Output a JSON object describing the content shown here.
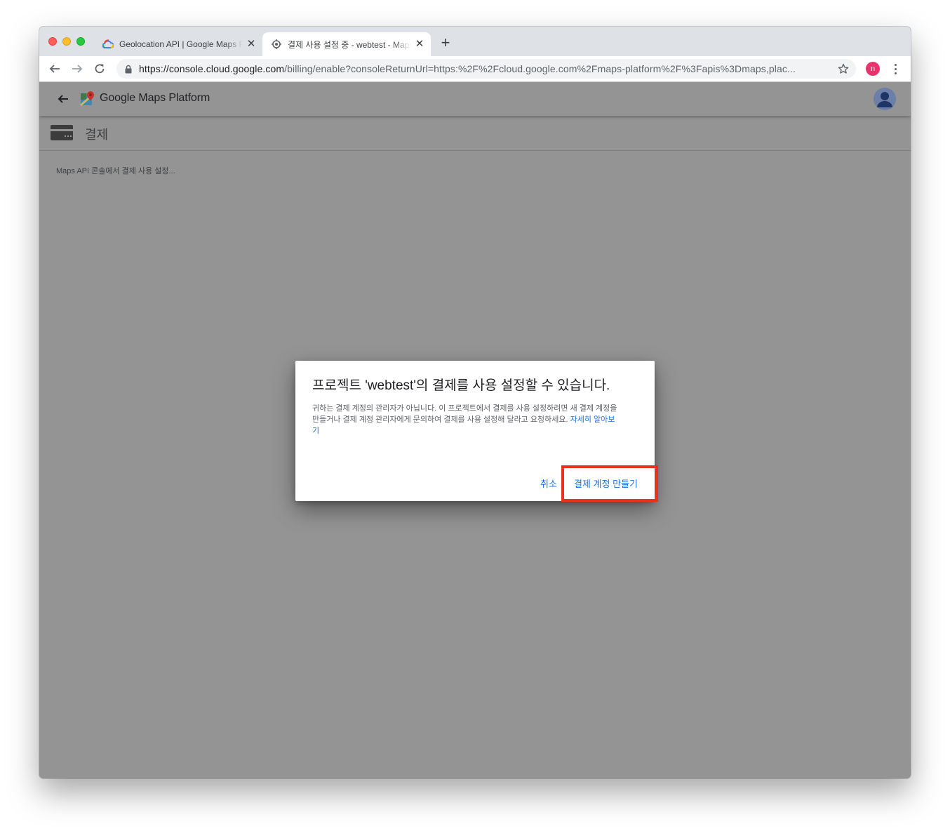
{
  "browser": {
    "tabs": [
      {
        "title": "Geolocation API | Google Maps Platform",
        "active": false,
        "favicon": "google-cloud-icon"
      },
      {
        "title": "결제 사용 설정 중 - webtest - Maps Platform",
        "active": true,
        "favicon": "gear-icon"
      }
    ],
    "url_host": "https://console.cloud.google.com",
    "url_rest": "/billing/enable?consoleReturnUrl=https:%2F%2Fcloud.google.com%2Fmaps-platform%2F%3Fapis%3Dmaps,plac...",
    "profile_initial": "n"
  },
  "app": {
    "brand": "Google Maps Platform",
    "section_title": "결제",
    "status_text": "Maps API 콘솔에서 결제 사용 설정..."
  },
  "dialog": {
    "title": "프로젝트 'webtest'의 결제를 사용 설정할 수 있습니다.",
    "body": "귀하는 결제 계정의 관리자가 아닙니다. 이 프로젝트에서 결제를 사용 설정하려면 새 결제 계정을 만들거나 결제 계정 관리자에게 문의하여 결제를 사용 설정해 달라고 요청하세요. ",
    "learn_more": "자세히 알아보기",
    "cancel_label": "취소",
    "create_label": "결제 계정 만들기"
  },
  "colors": {
    "accent": "#1a73e8",
    "overlay_bg": "#949494",
    "highlight": "#e8321f",
    "profile": "#e8336d"
  }
}
